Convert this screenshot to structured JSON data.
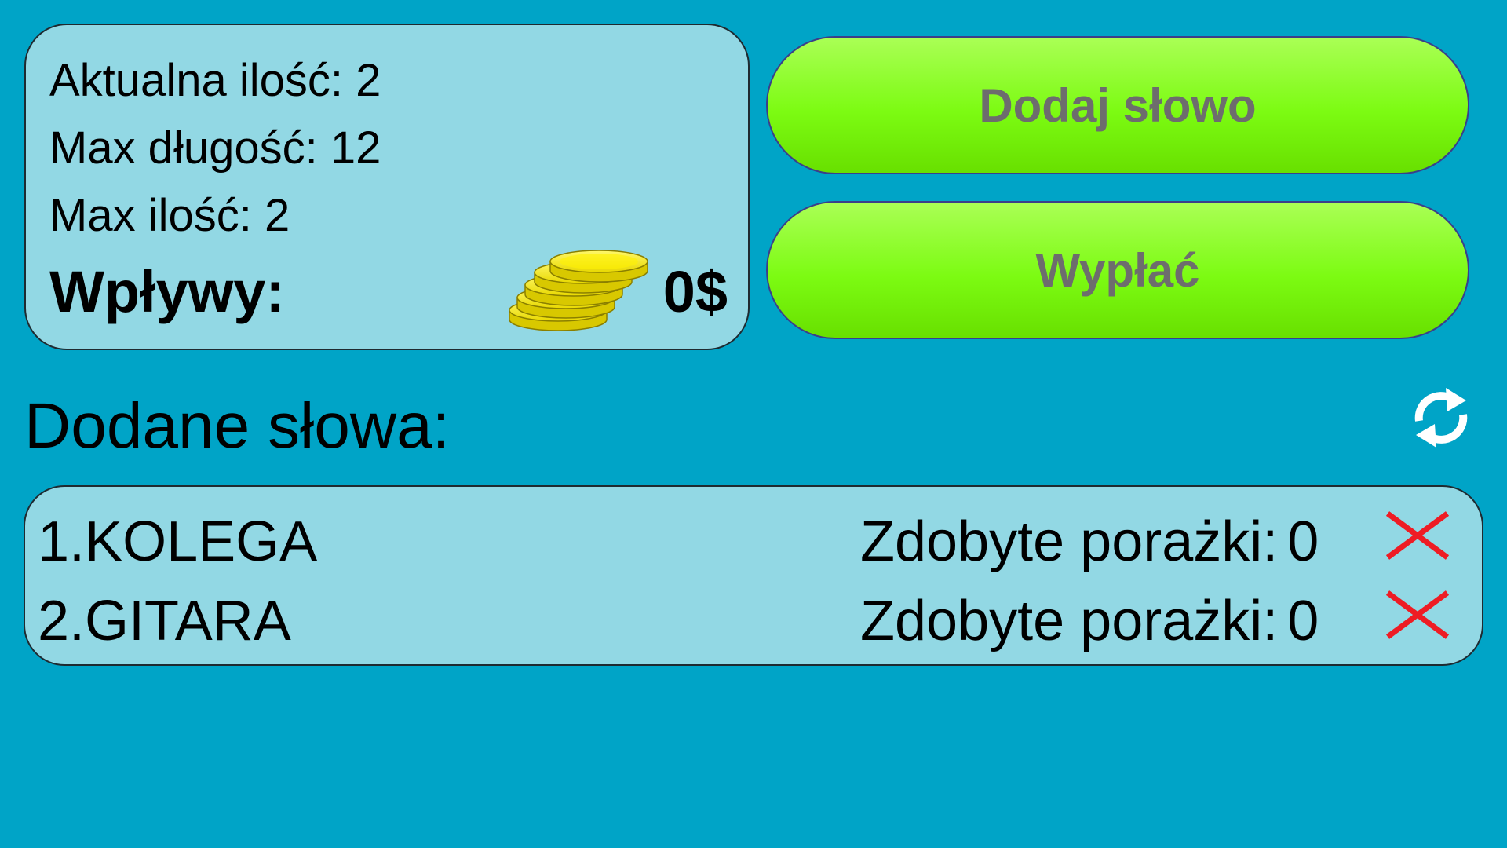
{
  "stats": {
    "current_count": "Aktualna ilość: 2",
    "max_length": "Max długość: 12",
    "max_count": "Max ilość: 2",
    "income_label": "Wpływy:",
    "income_value": "0$"
  },
  "buttons": {
    "add_word": "Dodaj słowo",
    "withdraw": "Wypłać"
  },
  "words": {
    "title": "Dodane słowa:",
    "losses_label": "Zdobyte porażki:",
    "items": [
      {
        "name": "1.KOLEGA",
        "losses": "0"
      },
      {
        "name": "2.GITARA",
        "losses": "0"
      }
    ]
  },
  "icons": {
    "coins": "coins-stack-icon",
    "refresh": "refresh-icon",
    "delete": "close-icon"
  },
  "colors": {
    "background": "#00a4c7",
    "panel": "#92d8e4",
    "button_green": "#7cfb12",
    "button_text": "#6d6d6d",
    "delete_red": "#ee1c24"
  }
}
